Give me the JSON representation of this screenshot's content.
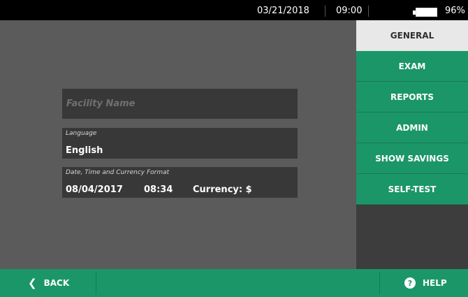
{
  "status_bar": {
    "date": "03/21/2018",
    "time": "09:00",
    "battery": "96%"
  },
  "fields": {
    "facility": {
      "placeholder": "Facility Name"
    },
    "language": {
      "label": "Language",
      "value": "English"
    },
    "datetime": {
      "label": "Date, Time and Currency Format",
      "date": "08/04/2017",
      "time": "08:34",
      "currency": "Currency: $"
    }
  },
  "sidebar": {
    "tabs": [
      {
        "label": "GENERAL",
        "active": true
      },
      {
        "label": "EXAM"
      },
      {
        "label": "REPORTS"
      },
      {
        "label": "ADMIN"
      },
      {
        "label": "SHOW SAVINGS"
      },
      {
        "label": "SELF-TEST"
      }
    ]
  },
  "bottom_bar": {
    "back_label": "BACK",
    "help_label": "HELP",
    "back_icon": "chevron-left-icon",
    "help_icon": "question-icon"
  },
  "colors": {
    "accent": "#1b9669",
    "content_bg": "#5b5b5b",
    "field_bg": "#383838"
  }
}
